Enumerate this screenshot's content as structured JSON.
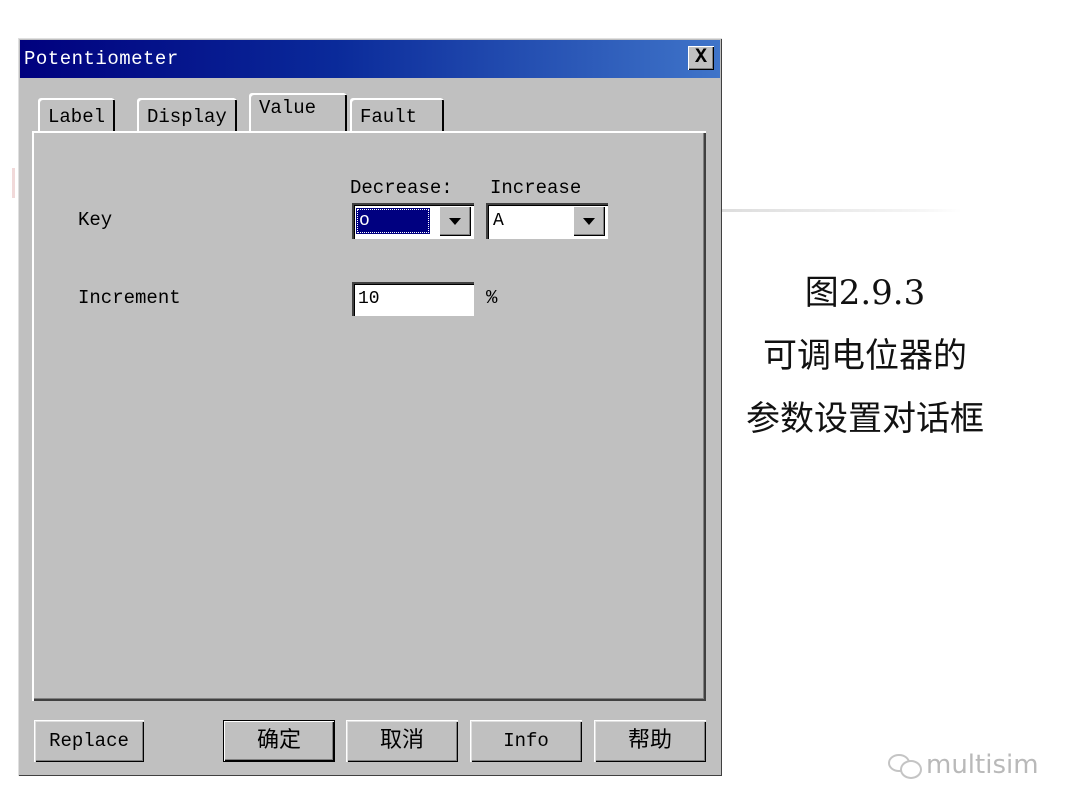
{
  "dialog": {
    "title": "Potentiometer",
    "close_glyph": "X",
    "tabs": [
      {
        "label": "Label",
        "active": false
      },
      {
        "label": "Display",
        "active": false
      },
      {
        "label": "Value",
        "active": true
      },
      {
        "label": "Fault",
        "active": false
      }
    ],
    "value_tab": {
      "key_label": "Key",
      "decrease_label": "Decrease:",
      "increase_label": "Increase",
      "decrease_value": "o",
      "increase_value": "A",
      "increment_label": "Increment",
      "increment_value": "10",
      "increment_unit": "%"
    },
    "buttons": {
      "replace": "Replace",
      "ok": "确定",
      "cancel": "取消",
      "info": "Info",
      "help": "帮助"
    }
  },
  "caption": {
    "line1": "图2.9.3",
    "line2": "可调电位器的",
    "line3": "参数设置对话框"
  },
  "watermark": {
    "text": "multisim",
    "icon": "wechat-icon"
  }
}
